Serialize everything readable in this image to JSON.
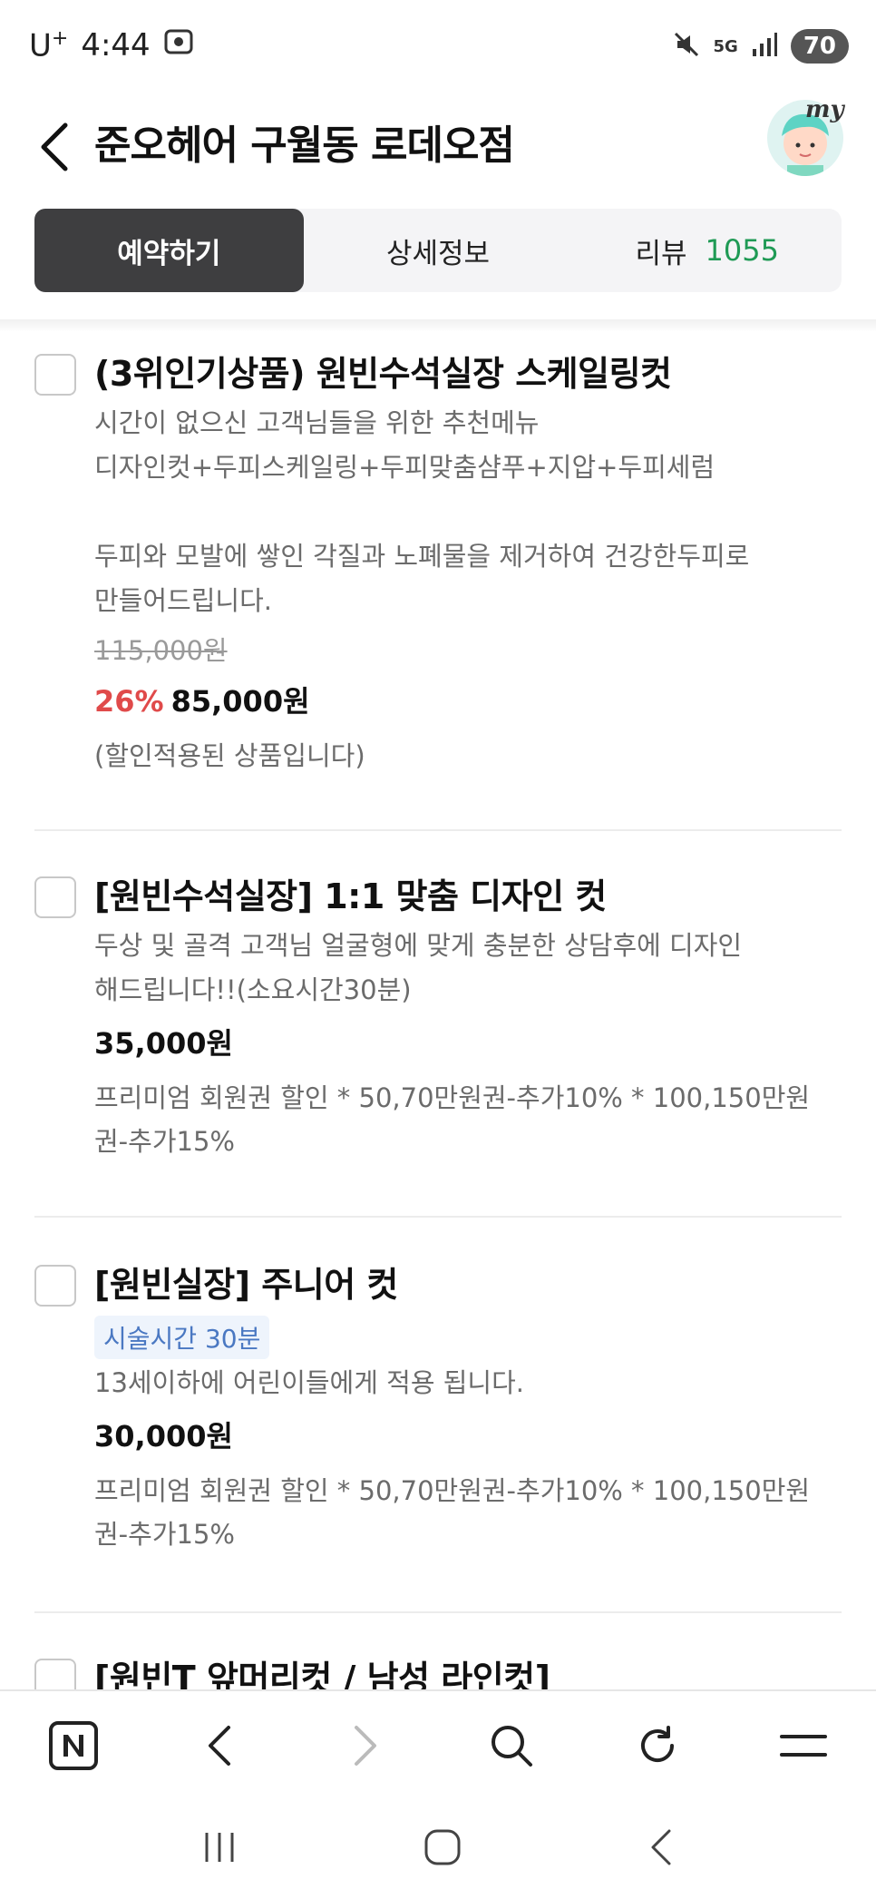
{
  "status_bar": {
    "carrier": "U",
    "carrier_sup": "+",
    "time": "4:44",
    "network": "5G",
    "battery": "70"
  },
  "header": {
    "title": "준오헤어 구월동 로데오점",
    "avatar_label": "my"
  },
  "tabs": [
    {
      "label": "예약하기",
      "active": true
    },
    {
      "label": "상세정보"
    },
    {
      "label": "리뷰",
      "count": "1055"
    }
  ],
  "items": [
    {
      "title": "(3위인기상품) 원빈수석실장 스케일링컷",
      "description": "시간이 없으신 고객님들을 위한 추천메뉴\n디자인컷+두피스케일링+두피맞춤샴푸+지압+두피세럼\n\n두피와 모발에 쌓인 각질과 노폐물을 제거하여 건강한두피로\n만들어드립니다.",
      "original_price": "115,000원",
      "discount": "26%",
      "price": "85,000원",
      "note": "(할인적용된 상품입니다)"
    },
    {
      "title": "[원빈수석실장] 1:1 맞춤 디자인 컷",
      "description": "두상 및 골격 고객님 얼굴형에 맞게 충분한 상담후에 디자인\n해드립니다!!(소요시간30분)",
      "price": "35,000원",
      "note": "프리미엄 회원권 할인 * 50,70만원권-추가10% * 100,150만원\n권-추가15%"
    },
    {
      "title": "[원빈실장] 주니어 컷",
      "badge": "시술시간 30분",
      "description": "13세이하에 어린이들에게 적용 됩니다.",
      "price": "30,000원",
      "note": "프리미엄 회원권 할인 * 50,70만원권-추가10% * 100,150만원\n권-추가15%"
    },
    {
      "title": "[원빈T 앞머리컷 / 남성 라인컷]"
    }
  ],
  "icons": {
    "back": "chevron-left-icon",
    "naver": "naver-n-icon",
    "browser_back": "chevron-left-icon",
    "browser_forward": "chevron-right-icon",
    "search": "search-icon",
    "refresh": "refresh-icon",
    "menu": "menu-icon"
  },
  "colors": {
    "accent_green": "#1f9a55",
    "discount_red": "#e04a4a",
    "active_tab": "#3e3e40",
    "badge_blue": "#4a78c2"
  }
}
